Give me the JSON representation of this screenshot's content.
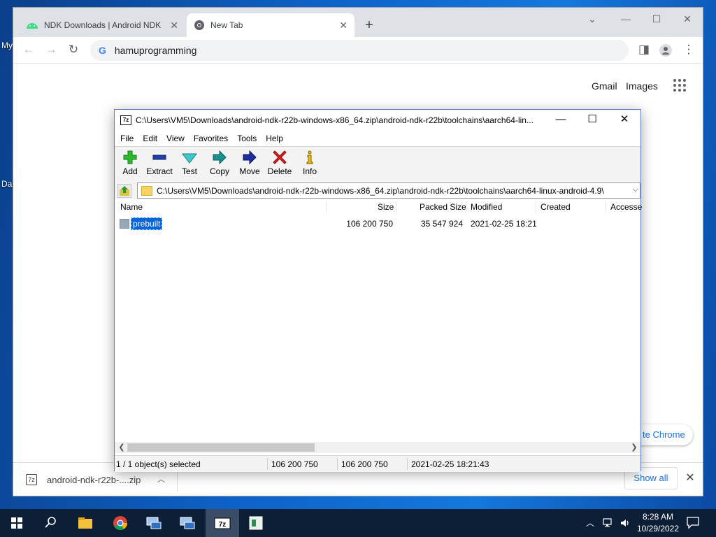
{
  "desktop": {
    "fragments": [
      "My",
      "Da"
    ]
  },
  "chrome": {
    "tabs": [
      {
        "title": "NDK Downloads  |  Android NDK",
        "icon": "android-icon"
      },
      {
        "title": "New Tab",
        "icon": "chrome-icon"
      }
    ],
    "new_tab": "+",
    "omnibox_text": "hamuprogramming",
    "links": {
      "gmail": "Gmail",
      "images": "Images"
    },
    "customize_text": "te Chrome",
    "downloads": {
      "filename": "android-ndk-r22b-....zip",
      "show_all": "Show all"
    }
  },
  "zip": {
    "title": "C:\\Users\\VM5\\Downloads\\android-ndk-r22b-windows-x86_64.zip\\android-ndk-r22b\\toolchains\\aarch64-lin...",
    "menu": [
      "File",
      "Edit",
      "View",
      "Favorites",
      "Tools",
      "Help"
    ],
    "toolbar": {
      "add": "Add",
      "extract": "Extract",
      "test": "Test",
      "copy": "Copy",
      "move": "Move",
      "delete": "Delete",
      "info": "Info"
    },
    "address": "C:\\Users\\VM5\\Downloads\\android-ndk-r22b-windows-x86_64.zip\\android-ndk-r22b\\toolchains\\aarch64-linux-android-4.9\\",
    "columns": {
      "name": "Name",
      "size": "Size",
      "packed": "Packed Size",
      "modified": "Modified",
      "created": "Created",
      "accessed": "Accesse"
    },
    "rows": [
      {
        "name": "prebuilt",
        "size": "106 200 750",
        "packed": "35 547 924",
        "modified": "2021-02-25 18:21",
        "created": "",
        "accessed": ""
      }
    ],
    "status": {
      "selection": "1 / 1 object(s) selected",
      "size": "106 200 750",
      "packed": "106 200 750",
      "modified": "2021-02-25 18:21:43"
    }
  },
  "taskbar": {
    "time": "8:28 AM",
    "date": "10/29/2022"
  }
}
